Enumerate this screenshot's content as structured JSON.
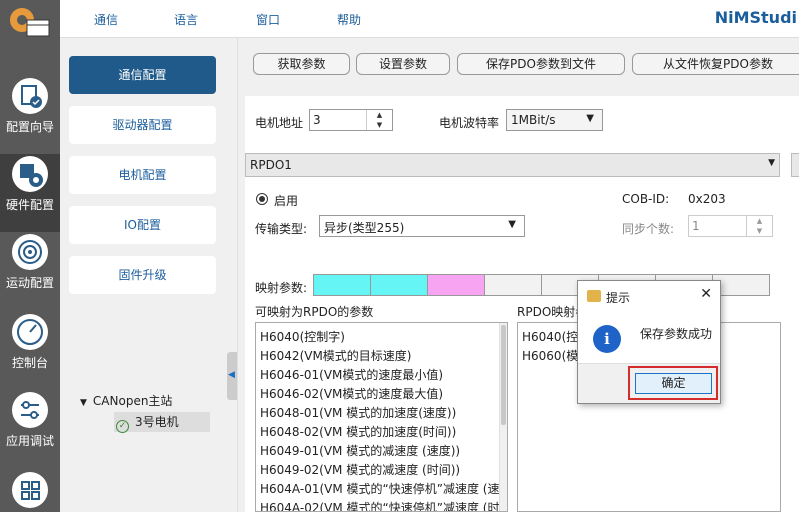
{
  "sidebar": {
    "items": [
      {
        "label": "配置向导",
        "icon": "wizard-icon"
      },
      {
        "label": "硬件配置",
        "icon": "hardware-icon"
      },
      {
        "label": "运动配置",
        "icon": "motion-icon"
      },
      {
        "label": "控制台",
        "icon": "gauge-icon"
      },
      {
        "label": "应用调试",
        "icon": "sliders-icon"
      },
      {
        "label": "",
        "icon": "grid-icon"
      }
    ]
  },
  "menu": {
    "items": [
      "通信",
      "语言",
      "窗口",
      "帮助"
    ],
    "brand": "NiMStudi"
  },
  "subnav": {
    "items": [
      "通信配置",
      "驱动器配置",
      "电机配置",
      "IO配置",
      "固件升级"
    ],
    "tree_root": "CANopen主站",
    "tree_child": "3号电机"
  },
  "toolbar": {
    "buttons": [
      "获取参数",
      "设置参数",
      "保存PDO参数到文件",
      "从文件恢复PDO参数"
    ]
  },
  "form": {
    "motor_addr_label": "电机地址",
    "motor_addr_value": "3",
    "baud_label": "电机波特率",
    "baud_value": "1MBit/s",
    "rpdo_select": "RPDO1",
    "enable_label": "启用",
    "cobid_label": "COB-ID:",
    "cobid_value": "0x203",
    "trans_type_label": "传输类型:",
    "trans_type_value": "异步(类型255)",
    "sync_count_label": "同步个数:",
    "sync_count_value": "1",
    "map_label": "映射参数:"
  },
  "lists": {
    "mappable_title": "可映射为RPDO的参数",
    "mappable": [
      "H6040(控制字)",
      "H6042(VM模式的目标速度)",
      "H6046-01(VM模式的速度最小值)",
      "H6046-02(VM模式的速度最大值)",
      "H6048-01(VM 模式的加速度(速度))",
      "H6048-02(VM 模式的加速度(时间))",
      "H6049-01(VM 模式的减速度 (速度))",
      "H6049-02(VM 模式的减速度 (时间))",
      "H604A-01(VM 模式的“快速停机”减速度 (速",
      "H604A-02(VM 模式的“快速停机”减速度 (时"
    ],
    "mapped_title": "RPDO映射参",
    "mapped": [
      "H6040(控制",
      "H6060(模式"
    ]
  },
  "dialog": {
    "title": "提示",
    "message": "保存参数成功",
    "ok": "确定"
  },
  "colors": {
    "cell_cyan": "#66f5f5",
    "cell_pink": "#f7a5f2",
    "cell_empty": "#f2f2f2",
    "accent": "#1f5a8a"
  }
}
